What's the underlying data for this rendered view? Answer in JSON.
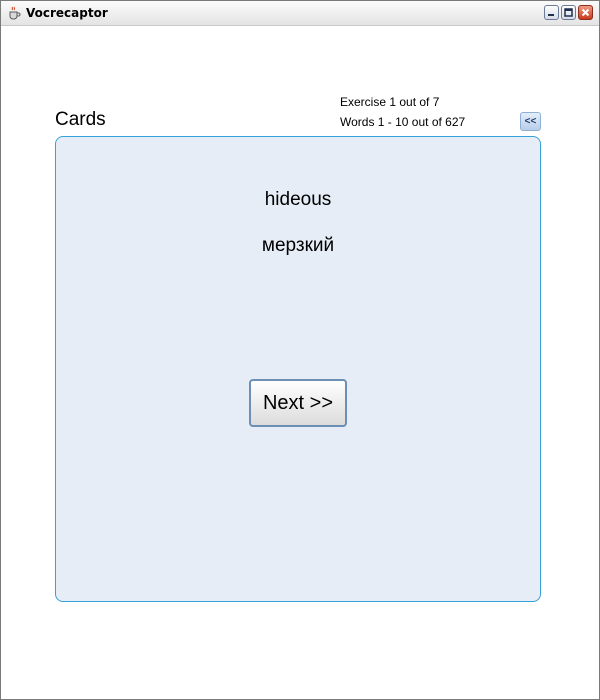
{
  "window": {
    "title": "Vocrecaptor",
    "app_icon": "java-coffee-cup-icon",
    "controls": {
      "minimize_icon": "minimize-icon",
      "maximize_icon": "maximize-icon",
      "close_icon": "close-icon"
    }
  },
  "header": {
    "section_title": "Cards",
    "exercise_status": "Exercise 1 out of 7",
    "words_status": "Words 1 - 10 out of 627",
    "back_button_label": "<<"
  },
  "card": {
    "front_word": "hideous",
    "back_word": "мерзкий",
    "next_button_label": "Next >>"
  },
  "colors": {
    "panel_background": "#e6edf6",
    "panel_border": "#35a2d8",
    "back_button_background": "#b7cde9",
    "close_button": "#c9391c"
  }
}
